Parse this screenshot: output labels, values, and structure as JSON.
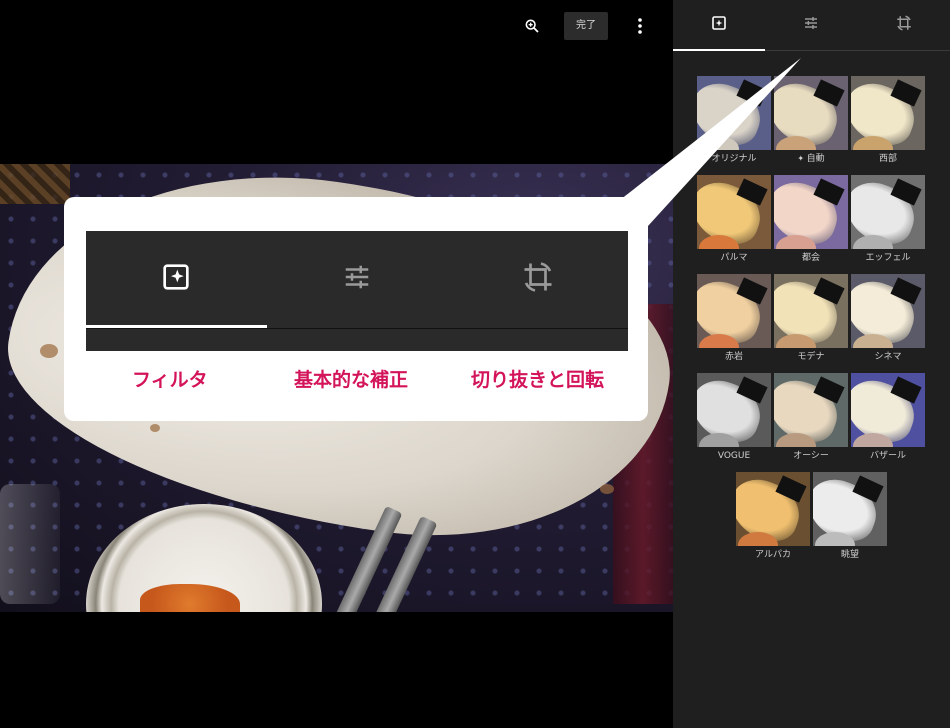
{
  "toolbar": {
    "zoom_icon": "zoom-in-icon",
    "done_label": "完了",
    "more_icon": "more-vert-icon"
  },
  "side_tabs": [
    {
      "id": "filters",
      "icon": "filter-icon",
      "active": true
    },
    {
      "id": "adjust",
      "icon": "tune-icon",
      "active": false
    },
    {
      "id": "crop",
      "icon": "crop-rotate-icon",
      "active": false
    }
  ],
  "filters": [
    {
      "label": "オリジナル",
      "tone": "original"
    },
    {
      "label": "自動",
      "icon": "auto-sparkle-icon",
      "tone": "auto"
    },
    {
      "label": "西部",
      "tone": "west"
    },
    {
      "label": "パルマ",
      "tone": "palma"
    },
    {
      "label": "都会",
      "tone": "metro"
    },
    {
      "label": "エッフェル",
      "tone": "eiffel"
    },
    {
      "label": "赤岩",
      "tone": "redrock"
    },
    {
      "label": "モデナ",
      "tone": "modena"
    },
    {
      "label": "シネマ",
      "tone": "cinema"
    },
    {
      "label": "VOGUE",
      "tone": "vogue"
    },
    {
      "label": "オーシー",
      "tone": "ollie"
    },
    {
      "label": "バザール",
      "tone": "bazaar"
    },
    {
      "label": "アルパカ",
      "tone": "alpaca"
    },
    {
      "label": "眺望",
      "tone": "vista"
    }
  ],
  "callout": {
    "labels": [
      "フィルタ",
      "基本的な補正",
      "切り抜きと回転"
    ],
    "label_color": "#d4145a"
  },
  "colors": {
    "side_panel": "#1f1f1f",
    "callout_bar": "#2a2a2a",
    "accent": "#d4145a"
  }
}
